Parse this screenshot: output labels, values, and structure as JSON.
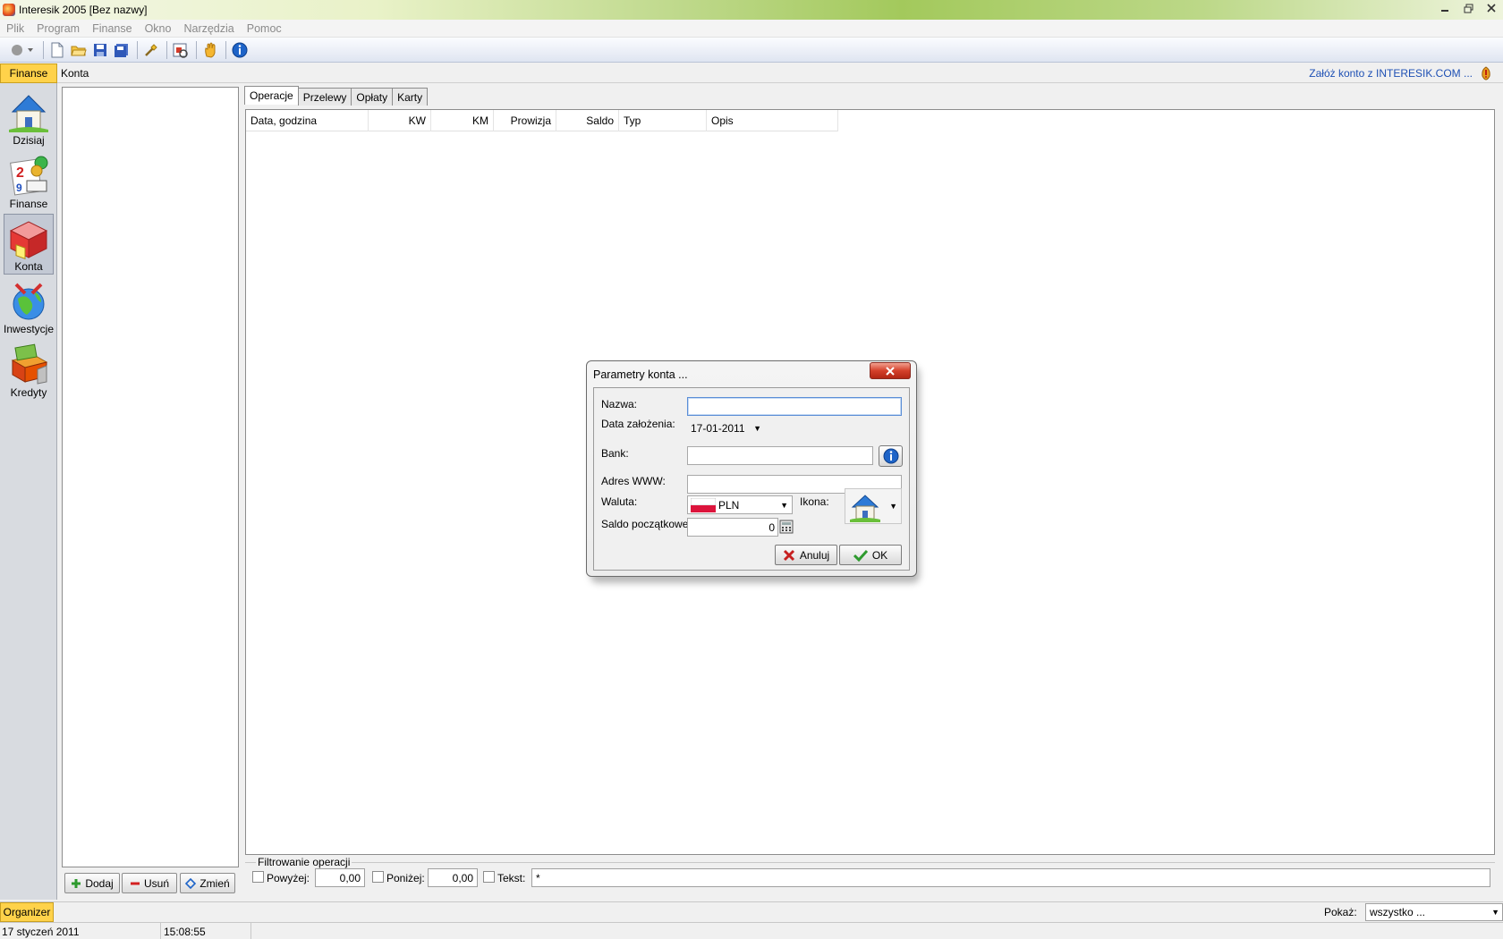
{
  "window": {
    "title": "Interesik 2005 [Bez nazwy]",
    "controls": [
      "minimize",
      "restore",
      "close"
    ]
  },
  "menu": [
    "Plik",
    "Program",
    "Finanse",
    "Okno",
    "Narzędzia",
    "Pomoc"
  ],
  "header": {
    "section": "Finanse",
    "crumb": "Konta",
    "link": "Załóż konto z INTERESIK.COM ..."
  },
  "nav": [
    {
      "label": "Dzisiaj",
      "icon": "house-icon"
    },
    {
      "label": "Finanse",
      "icon": "finance-icon"
    },
    {
      "label": "Konta",
      "icon": "accounts-icon",
      "active": true
    },
    {
      "label": "Inwestycje",
      "icon": "globe-icon"
    },
    {
      "label": "Kredyty",
      "icon": "credit-icon"
    }
  ],
  "left_buttons": {
    "add": "Dodaj",
    "remove": "Usuń",
    "edit": "Zmień"
  },
  "tabs": [
    "Operacje",
    "Przelewy",
    "Opłaty",
    "Karty"
  ],
  "table": {
    "columns": [
      "Data, godzina",
      "KW",
      "KM",
      "Prowizja",
      "Saldo",
      "Typ",
      "Opis"
    ]
  },
  "filter": {
    "legend": "Filtrowanie operacji",
    "above_label": "Powyżej:",
    "above_value": "0,00",
    "below_label": "Poniżej:",
    "below_value": "0,00",
    "text_label": "Tekst:",
    "text_value": "*"
  },
  "bottom": {
    "section": "Organizer",
    "show_label": "Pokaż:",
    "show_value": "wszystko ..."
  },
  "status": {
    "date": "17 styczeń 2011",
    "time": "15:08:55"
  },
  "dialog": {
    "title": "Parametry konta ...",
    "name_label": "Nazwa:",
    "name_value": "",
    "date_label": "Data założenia:",
    "date_value": "17-01-2011",
    "bank_label": "Bank:",
    "bank_value": "",
    "www_label": "Adres WWW:",
    "www_value": "",
    "currency_label": "Waluta:",
    "currency_value": "PLN",
    "icon_label": "Ikona:",
    "balance_label": "Saldo początkowe:",
    "balance_value": "0",
    "cancel_label": "Anuluj",
    "ok_label": "OK"
  },
  "colors": {
    "section_bg": "#ffd24a",
    "link": "#1e50b4",
    "close_button": "#d4402a"
  }
}
